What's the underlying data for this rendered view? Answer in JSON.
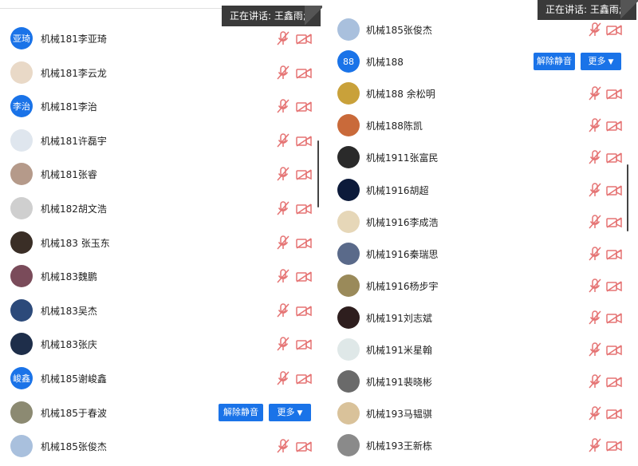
{
  "speaker_label": "正在讲话: 王鑫雨;",
  "unmute_label": "解除静音",
  "more_label": "更多",
  "colors": {
    "accent": "#1a73e8",
    "muted_icon": "#e57373",
    "bar": "#3a3a3a"
  },
  "left": {
    "rows": [
      {
        "name": "机械181李亚琦",
        "avatar_text": "亚琦",
        "avatar_color": "#1a73e8"
      },
      {
        "name": "机械181李云龙",
        "avatar_text": "",
        "avatar_color": "#e9d9c7"
      },
      {
        "name": "机械181李治",
        "avatar_text": "李治",
        "avatar_color": "#1a73e8"
      },
      {
        "name": "机械181许磊宇",
        "avatar_text": "",
        "avatar_color": "#dfe6ee"
      },
      {
        "name": "机械181张睿",
        "avatar_text": "",
        "avatar_color": "#b59a8a"
      },
      {
        "name": "机械182胡文浩",
        "avatar_text": "",
        "avatar_color": "#cfcfcf"
      },
      {
        "name": "机械183 张玉东",
        "avatar_text": "",
        "avatar_color": "#3a2e26"
      },
      {
        "name": "机械183魏鹏",
        "avatar_text": "",
        "avatar_color": "#7a4b5a"
      },
      {
        "name": "机械183吴杰",
        "avatar_text": "",
        "avatar_color": "#2c4a7a"
      },
      {
        "name": "机械183张庆",
        "avatar_text": "",
        "avatar_color": "#1e2e4a"
      },
      {
        "name": "机械185谢峻鑫",
        "avatar_text": "峻鑫",
        "avatar_color": "#1a73e8"
      },
      {
        "name": "机械185于春波",
        "avatar_text": "",
        "avatar_color": "#8c8a72",
        "buttons": true
      },
      {
        "name": "机械185张俊杰",
        "avatar_text": "",
        "avatar_color": "#a9c0dd"
      }
    ]
  },
  "right": {
    "rows": [
      {
        "name": "机械185张俊杰",
        "avatar_text": "",
        "avatar_color": "#a9c0dd"
      },
      {
        "name": "机械188",
        "avatar_text": "88",
        "avatar_color": "#1a73e8",
        "buttons": true
      },
      {
        "name": "机械188 余松明",
        "avatar_text": "",
        "avatar_color": "#c9a13a"
      },
      {
        "name": "机械188陈凯",
        "avatar_text": "",
        "avatar_color": "#c96a3a"
      },
      {
        "name": "机械1911张富民",
        "avatar_text": "",
        "avatar_color": "#2a2a2a"
      },
      {
        "name": "机械1916胡超",
        "avatar_text": "",
        "avatar_color": "#0c1a3a"
      },
      {
        "name": "机械1916李成浩",
        "avatar_text": "",
        "avatar_color": "#e6d7b8"
      },
      {
        "name": "机械1916秦瑞思",
        "avatar_text": "",
        "avatar_color": "#5a6a8a"
      },
      {
        "name": "机械1916杨步宇",
        "avatar_text": "",
        "avatar_color": "#9a8a5a"
      },
      {
        "name": "机械191刘志斌",
        "avatar_text": "",
        "avatar_color": "#2e1e1e"
      },
      {
        "name": "机械191米星翰",
        "avatar_text": "",
        "avatar_color": "#dfe8e8"
      },
      {
        "name": "机械191裴晓彬",
        "avatar_text": "",
        "avatar_color": "#6a6a6a"
      },
      {
        "name": "机械193马韫骐",
        "avatar_text": "",
        "avatar_color": "#d9c29a"
      },
      {
        "name": "机械193王新栋",
        "avatar_text": "",
        "avatar_color": "#8a8a8a"
      }
    ]
  }
}
